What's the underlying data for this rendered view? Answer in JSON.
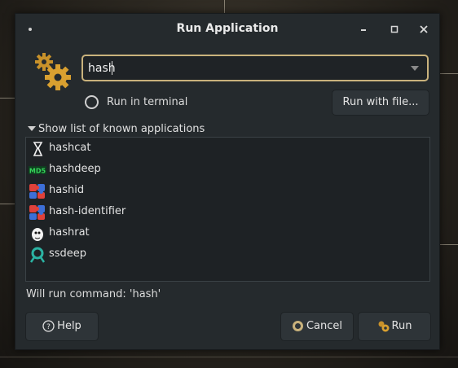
{
  "window": {
    "title": "Run Application"
  },
  "titlebar": {
    "minimize_icon": "minimize-icon",
    "maximize_icon": "maximize-icon",
    "close_icon": "close-icon"
  },
  "entry": {
    "value": "hash",
    "dropdown_icon": "chevron-down-icon"
  },
  "options": {
    "run_in_terminal_label": "Run in terminal",
    "run_with_file_label": "Run with file..."
  },
  "expander": {
    "label": "Show list of known applications"
  },
  "apps": [
    {
      "name": "hashcat",
      "icon": "hashcat-icon"
    },
    {
      "name": "hashdeep",
      "icon": "md5-icon"
    },
    {
      "name": "hashid",
      "icon": "puzzle-icon"
    },
    {
      "name": "hash-identifier",
      "icon": "puzzle-icon"
    },
    {
      "name": "hashrat",
      "icon": "rat-icon"
    },
    {
      "name": "ssdeep",
      "icon": "magnifier-icon"
    }
  ],
  "status": {
    "text": "Will run command: 'hash'"
  },
  "buttons": {
    "help": "Help",
    "cancel": "Cancel",
    "run": "Run"
  },
  "colors": {
    "accent": "#c9b27c",
    "dialog_bg": "#252a2d",
    "list_bg": "#1e2225"
  }
}
